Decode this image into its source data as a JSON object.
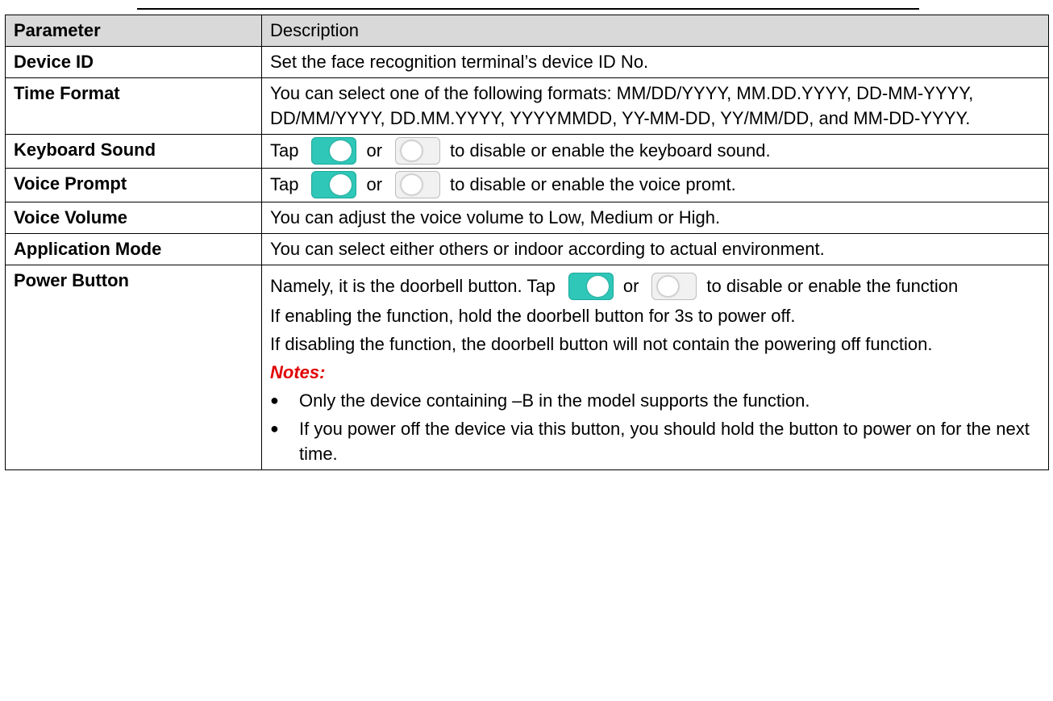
{
  "table": {
    "header": {
      "param": "Parameter",
      "desc": "Description"
    },
    "rows": {
      "device_id": {
        "name": "Device ID",
        "desc": "Set the face recognition terminal’s device ID No."
      },
      "time_format": {
        "name": "Time Format",
        "desc": "You can select one of the following formats: MM/DD/YYYY, MM.DD.YYYY, DD-MM-YYYY, DD/MM/YYYY, DD.MM.YYYY, YYYYMMDD, YY-MM-DD, YY/MM/DD, and MM-DD-YYYY."
      },
      "keyboard_sound": {
        "name": "Keyboard Sound",
        "pre": "Tap",
        "mid": "or",
        "post": "to disable or enable the keyboard sound."
      },
      "voice_prompt": {
        "name": "Voice Prompt",
        "pre": "Tap",
        "mid": "or",
        "post": "to disable or enable the voice promt."
      },
      "voice_volume": {
        "name": "Voice Volume",
        "desc": "You can adjust the voice volume to Low, Medium or High."
      },
      "application_mode": {
        "name": "Application Mode",
        "desc": "You can select either others or indoor according to actual environment."
      },
      "power_button": {
        "name": "Power Button",
        "pre": "Namely, it is the doorbell button. Tap",
        "mid": "or",
        "post": "to disable or enable the function",
        "enable_text": "If enabling the function, hold the doorbell button for 3s to power off.",
        "disable_text": "If disabling the function, the doorbell button will not contain the powering off function.",
        "notes_title": "Notes:",
        "notes": [
          "Only the device containing –B in the model supports the function.",
          "If you power off the device via this button, you should hold the button to power on for the next time."
        ]
      }
    }
  },
  "icons": {
    "toggle_on": "toggle-on-icon",
    "toggle_off": "toggle-off-icon",
    "bullet": "bullet-icon"
  },
  "colors": {
    "header_bg": "#d9d9d9",
    "toggle_on": "#2fc7b8",
    "toggle_off": "#f1f1f1",
    "notes": "#e00000"
  }
}
